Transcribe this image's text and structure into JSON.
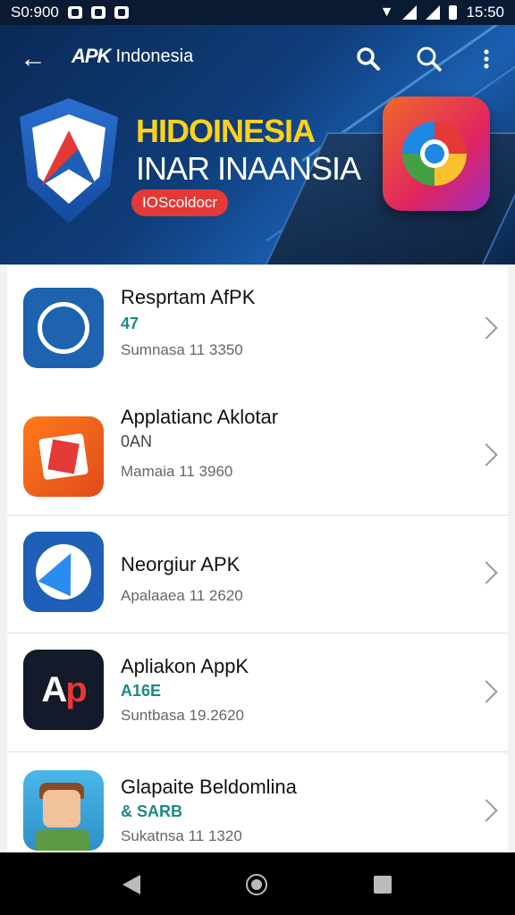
{
  "status_bar": {
    "time_left": "S0:900",
    "time_right": "15:50"
  },
  "header": {
    "brand_logo": "APK",
    "brand_title": "Indonesia",
    "hero_line1": "HIDOINESIA",
    "hero_line2": "INAR INAANSIA",
    "pill_label": "IOScoldocr"
  },
  "apps": [
    {
      "name": "Resprtam AfPK",
      "meta": "47",
      "date": "Sumnasa 11 3350",
      "icon": "chat-face-icon"
    },
    {
      "name": "Applatianc Aklotar",
      "meta": "0AN",
      "date": "Mamaia 11 3960",
      "icon": "puzzle-icon"
    },
    {
      "name": "Neorgiur APK",
      "meta": "",
      "date": "Apalaaea 11 2620",
      "icon": "navigation-arrow-icon"
    },
    {
      "name": "Apliakon AppK",
      "meta": "A16E",
      "date": "Suntbasa 19.2620",
      "icon": "ap-logo-icon"
    },
    {
      "name": "Glapaite Beldomlina",
      "meta": "& SARB",
      "date": "Sukatnsa 11 1320",
      "icon": "cartoon-face-icon"
    }
  ],
  "nav": {
    "back": "back",
    "home": "home",
    "recent": "recent"
  }
}
